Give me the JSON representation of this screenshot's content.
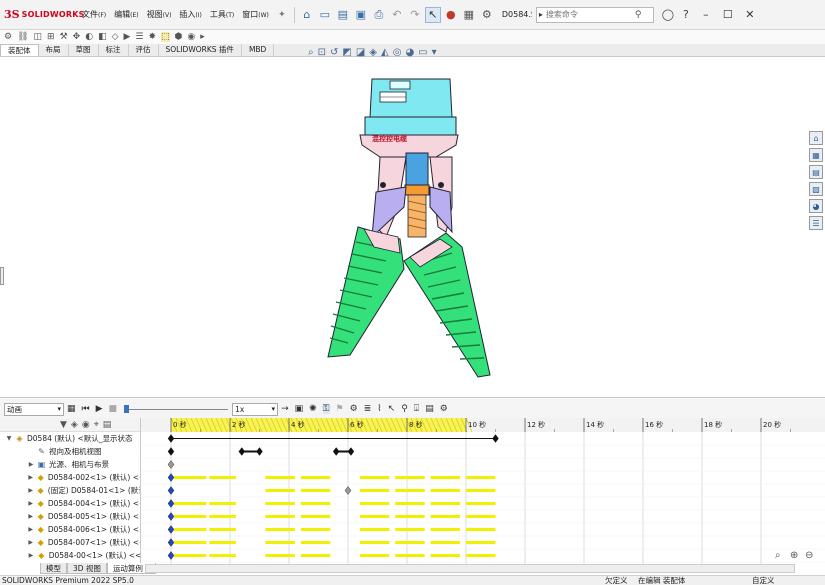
{
  "app": {
    "brand": "SOLIDWORKS",
    "logo_glyph": "3S",
    "document_name": "D0584.S...",
    "search_placeholder": "搜索命令"
  },
  "menu": [
    {
      "label": "文件",
      "accel": "(F)"
    },
    {
      "label": "编辑",
      "accel": "(E)"
    },
    {
      "label": "视图",
      "accel": "(V)"
    },
    {
      "label": "插入",
      "accel": "(I)"
    },
    {
      "label": "工具",
      "accel": "(T)"
    },
    {
      "label": "窗口",
      "accel": "(W)"
    }
  ],
  "tabs": [
    "装配体",
    "布局",
    "草图",
    "标注",
    "评估",
    "SOLIDWORKS 插件",
    "MBD"
  ],
  "model": {
    "label_on_motor": "混控控电缆"
  },
  "motion": {
    "study_type": "动画",
    "speed": "1x",
    "time_labels": [
      "0 秒",
      "2 秒",
      "4 秒",
      "6 秒",
      "8 秒",
      "10 秒",
      "12 秒",
      "14 秒",
      "16 秒",
      "18 秒",
      "20 秒"
    ],
    "tree": [
      {
        "expander": "▼",
        "icon": "assembly",
        "label": "D0584 (默认) <默认_显示状态"
      },
      {
        "expander": "",
        "icon": "camera",
        "label": "视向及相机视图"
      },
      {
        "expander": "▶",
        "icon": "light",
        "label": "光源、相机与布景"
      },
      {
        "expander": "▶",
        "icon": "part",
        "label": "D0584-002<1> (默认) <<"
      },
      {
        "expander": "▶",
        "icon": "part",
        "label": "(固定) D0584-01<1> (默认"
      },
      {
        "expander": "▶",
        "icon": "part",
        "label": "D0584-004<1> (默认) <<"
      },
      {
        "expander": "▶",
        "icon": "part",
        "label": "D0584-005<1> (默认) <<"
      },
      {
        "expander": "▶",
        "icon": "part",
        "label": "D0584-006<1> (默认) <<"
      },
      {
        "expander": "▶",
        "icon": "part",
        "label": "D0584-007<1> (默认) <<"
      },
      {
        "expander": "▶",
        "icon": "part",
        "label": "D0584-00<1> (默认) <<"
      }
    ]
  },
  "bottom_tabs": [
    "模型",
    "3D 视图",
    "运动算例 1"
  ],
  "status": {
    "left": "SOLIDWORKS Premium 2022 SP5.0",
    "state": "欠定义",
    "mode": "在编辑 装配体",
    "units": "自定义"
  },
  "colors": {
    "accent": "#d0021b",
    "timeline_header": "#f7f25a",
    "key_bar": "#f0f000",
    "motor_cyan": "#7fe8f0",
    "finger_green": "#33e07a",
    "frame_pink": "#f6d6dc"
  }
}
